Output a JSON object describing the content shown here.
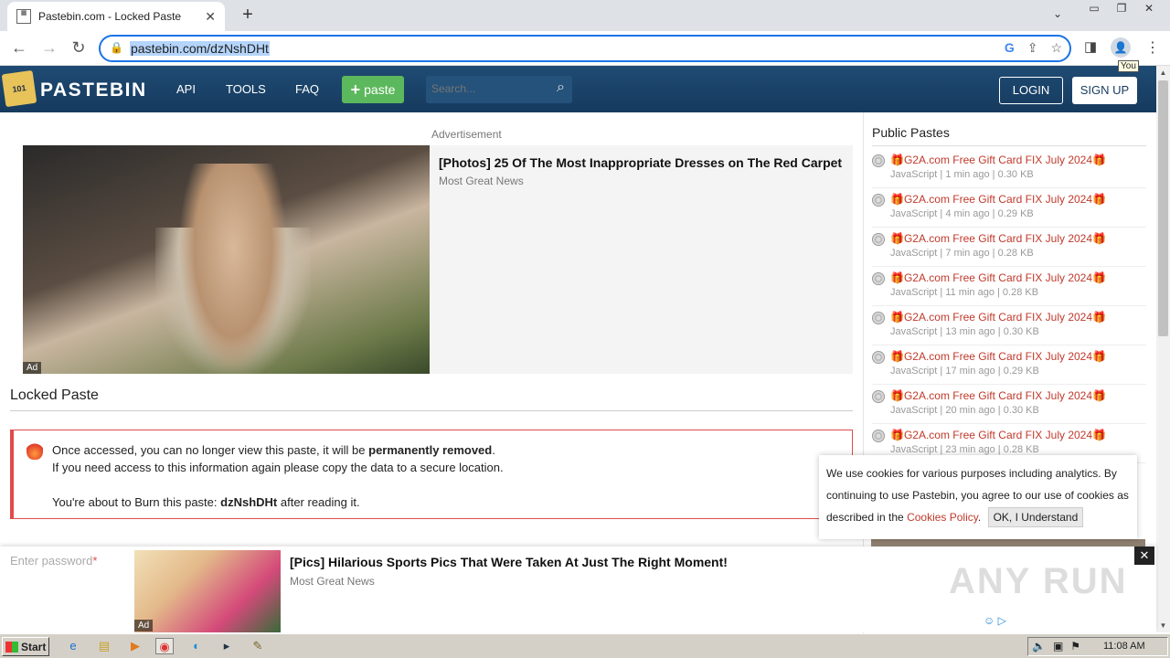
{
  "browser": {
    "tab_title": "Pastebin.com - Locked Paste",
    "tab_close": "✕",
    "new_tab": "+",
    "url": "pastebin.com/dzNshDHt",
    "profile_tooltip": "You"
  },
  "header": {
    "logo": "PASTEBIN",
    "nav": [
      "API",
      "TOOLS",
      "FAQ"
    ],
    "paste_button": "paste",
    "search_placeholder": "Search...",
    "login": "LOGIN",
    "signup": "SIGN UP"
  },
  "ad_top": {
    "label": "Advertisement",
    "title": "[Photos] 25 Of The Most Inappropriate Dresses on The Red Carpet",
    "source": "Most Great News",
    "tag": "Ad"
  },
  "main": {
    "section_title": "Locked Paste",
    "notice_line1_prefix": "Once accessed, you can no longer view this paste, it will be ",
    "notice_line1_bold": "permanently removed",
    "notice_line1_suffix": ".",
    "notice_line2": "If you need access to this information again please copy the data to a secure location.",
    "notice_line3_prefix": "You're about to Burn this paste: ",
    "notice_line3_bold": "dzNshDHt",
    "notice_line3_suffix": " after reading it.",
    "password_label": "Enter password",
    "password_required_mark": "*"
  },
  "sidebar": {
    "title": "Public Pastes",
    "items": [
      {
        "title": "🎁G2A.com Free Gift Card FIX July 2024🎁",
        "meta": "JavaScript | 1 min ago | 0.30 KB"
      },
      {
        "title": "🎁G2A.com Free Gift Card FIX July 2024🎁",
        "meta": "JavaScript | 4 min ago | 0.29 KB"
      },
      {
        "title": "🎁G2A.com Free Gift Card FIX July 2024🎁",
        "meta": "JavaScript | 7 min ago | 0.28 KB"
      },
      {
        "title": "🎁G2A.com Free Gift Card FIX July 2024🎁",
        "meta": "JavaScript | 11 min ago | 0.28 KB"
      },
      {
        "title": "🎁G2A.com Free Gift Card FIX July 2024🎁",
        "meta": "JavaScript | 13 min ago | 0.30 KB"
      },
      {
        "title": "🎁G2A.com Free Gift Card FIX July 2024🎁",
        "meta": "JavaScript | 17 min ago | 0.29 KB"
      },
      {
        "title": "🎁G2A.com Free Gift Card FIX July 2024🎁",
        "meta": "JavaScript | 20 min ago | 0.30 KB"
      },
      {
        "title": "🎁G2A.com Free Gift Card FIX July 2024🎁",
        "meta": "JavaScript | 23 min ago | 0.28 KB"
      }
    ]
  },
  "cookie": {
    "text": "We use cookies for various purposes including analytics. By continuing to use Pastebin, you agree to our use of cookies as described in the ",
    "link": "Cookies Policy",
    "after_link": ".",
    "button": "OK, I Understand"
  },
  "ad_bottom": {
    "title": "[Pics] Hilarious Sports Pics That Were Taken At Just The Right Moment!",
    "source": "Most Great News",
    "tag": "Ad",
    "close": "✕"
  },
  "watermark": "ANY RUN",
  "taskbar": {
    "start": "Start",
    "clock": "11:08 AM"
  },
  "colors": {
    "header_bg": "#1e4266",
    "paste_button": "#5cb85c",
    "accent_red": "#c0392b",
    "omnibox_focus": "#1a73e8"
  }
}
